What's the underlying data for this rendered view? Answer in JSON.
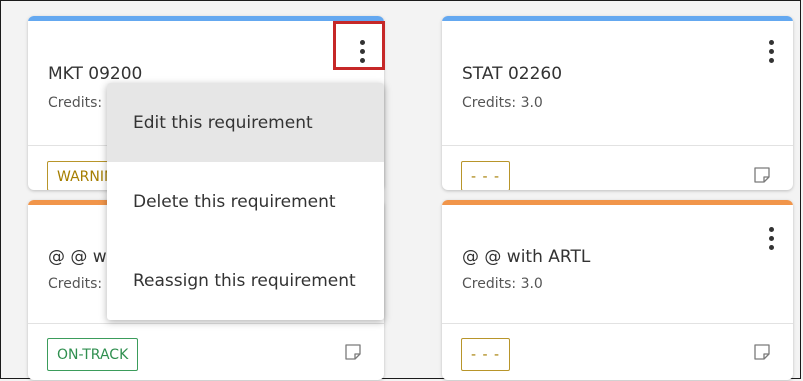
{
  "colors": {
    "accent_blue": "#64a8f0",
    "accent_orange": "#f1954a",
    "warning_gold": "#a57e00",
    "ontrack_green": "#2f8f4f",
    "highlight_red": "#c62828"
  },
  "cards": [
    {
      "title": "MKT 09200",
      "credits": "Credits:",
      "badge": "WARNING"
    },
    {
      "title": "STAT 02260",
      "credits": "Credits: 3.0",
      "badge": "- - -"
    },
    {
      "title": "@ @ with ARTL",
      "credits": "Credits:",
      "badge": "ON-TRACK"
    },
    {
      "title": "@ @ with ARTL",
      "credits": "Credits: 3.0",
      "badge": "- - -"
    }
  ],
  "icons": {
    "more": "more-vertical-icon",
    "note": "note-icon"
  },
  "menu": {
    "items": [
      {
        "label": "Edit this requirement",
        "selected": true
      },
      {
        "label": "Delete this requirement",
        "selected": false
      },
      {
        "label": "Reassign this requirement",
        "selected": false
      }
    ]
  }
}
